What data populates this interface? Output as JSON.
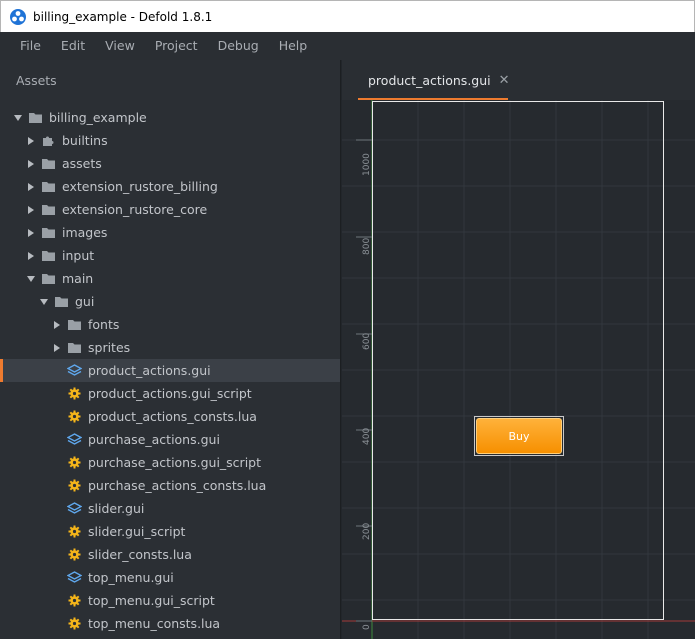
{
  "window": {
    "title": "billing_example - Defold 1.8.1",
    "accent": "#ee7b2f"
  },
  "menu": [
    "File",
    "Edit",
    "View",
    "Project",
    "Debug",
    "Help"
  ],
  "assets": {
    "title": "Assets",
    "tree": [
      {
        "label": "billing_example",
        "depth": 0,
        "kind": "folder",
        "expanded": true
      },
      {
        "label": "builtins",
        "depth": 1,
        "kind": "puzzle",
        "expanded": false
      },
      {
        "label": "assets",
        "depth": 1,
        "kind": "folder",
        "expanded": false
      },
      {
        "label": "extension_rustore_billing",
        "depth": 1,
        "kind": "folder",
        "expanded": false
      },
      {
        "label": "extension_rustore_core",
        "depth": 1,
        "kind": "folder",
        "expanded": false
      },
      {
        "label": "images",
        "depth": 1,
        "kind": "folder",
        "expanded": false
      },
      {
        "label": "input",
        "depth": 1,
        "kind": "folder",
        "expanded": false
      },
      {
        "label": "main",
        "depth": 1,
        "kind": "folder",
        "expanded": true
      },
      {
        "label": "gui",
        "depth": 2,
        "kind": "folder",
        "expanded": true
      },
      {
        "label": "fonts",
        "depth": 3,
        "kind": "folder",
        "expanded": false
      },
      {
        "label": "sprites",
        "depth": 3,
        "kind": "folder",
        "expanded": false
      },
      {
        "label": "product_actions.gui",
        "depth": 3,
        "kind": "gui",
        "selected": true
      },
      {
        "label": "product_actions.gui_script",
        "depth": 3,
        "kind": "script"
      },
      {
        "label": "product_actions_consts.lua",
        "depth": 3,
        "kind": "script"
      },
      {
        "label": "purchase_actions.gui",
        "depth": 3,
        "kind": "gui"
      },
      {
        "label": "purchase_actions.gui_script",
        "depth": 3,
        "kind": "script"
      },
      {
        "label": "purchase_actions_consts.lua",
        "depth": 3,
        "kind": "script"
      },
      {
        "label": "slider.gui",
        "depth": 3,
        "kind": "gui"
      },
      {
        "label": "slider.gui_script",
        "depth": 3,
        "kind": "script"
      },
      {
        "label": "slider_consts.lua",
        "depth": 3,
        "kind": "script"
      },
      {
        "label": "top_menu.gui",
        "depth": 3,
        "kind": "gui"
      },
      {
        "label": "top_menu.gui_script",
        "depth": 3,
        "kind": "script"
      },
      {
        "label": "top_menu_consts.lua",
        "depth": 3,
        "kind": "script"
      }
    ]
  },
  "editor": {
    "tab_label": "product_actions.gui",
    "close_glyph": "✕",
    "ruler_labels": [
      "1000",
      "800",
      "600",
      "400",
      "200",
      "0"
    ],
    "buy_label": "Buy"
  }
}
